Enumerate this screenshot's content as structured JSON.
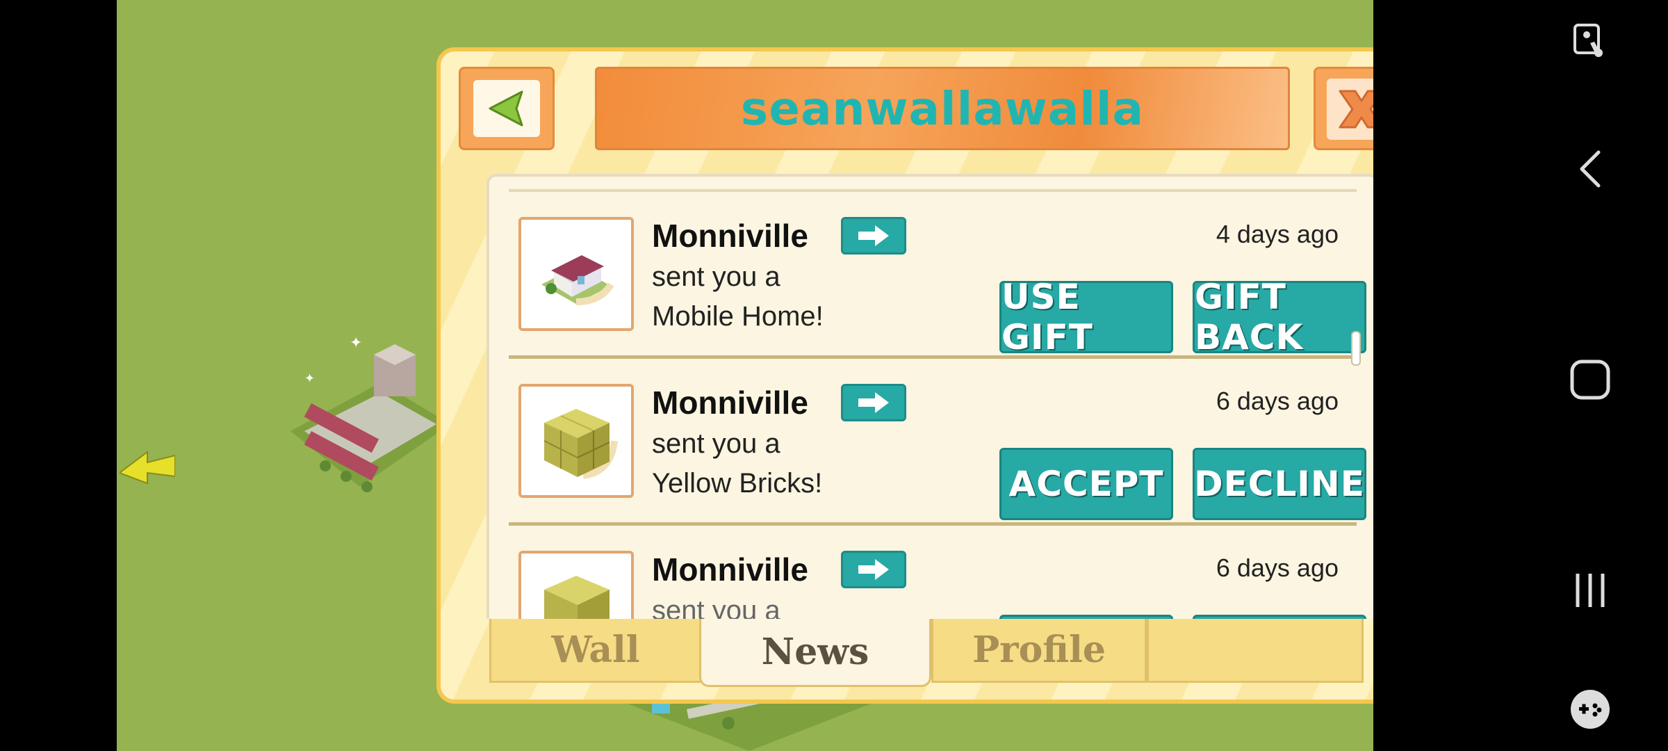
{
  "dialog": {
    "title": "seanwallawalla",
    "back_icon": "triangle-left-icon",
    "close_icon": "x-icon"
  },
  "news": [
    {
      "sender": "Monniville",
      "line1": "sent you a",
      "line2": "Mobile Home!",
      "time": "4 days ago",
      "primary": "USE GIFT",
      "secondary": "GIFT BACK",
      "thumbnail": "mobile-home-icon"
    },
    {
      "sender": "Monniville",
      "line1": "sent you a",
      "line2": "Yellow Bricks!",
      "time": "6 days ago",
      "primary": "ACCEPT",
      "secondary": "DECLINE",
      "thumbnail": "yellow-bricks-icon"
    },
    {
      "sender": "Monniville",
      "line1": "sent you a",
      "line2": "",
      "time": "6 days ago",
      "primary": "",
      "secondary": "",
      "thumbnail": "yellow-bricks-icon"
    }
  ],
  "tabs": [
    {
      "label": "Wall"
    },
    {
      "label": "News"
    },
    {
      "label": "Profile"
    },
    {
      "label": ""
    }
  ],
  "active_tab": "News",
  "colors": {
    "accent": "#27a9a5",
    "title": "#21b5b2",
    "dialog": "#fbe8a3",
    "orange": "#f28c3a"
  },
  "system_nav": [
    "accessibility-icon",
    "back-icon",
    "home-icon",
    "recents-icon",
    "game-icon"
  ]
}
